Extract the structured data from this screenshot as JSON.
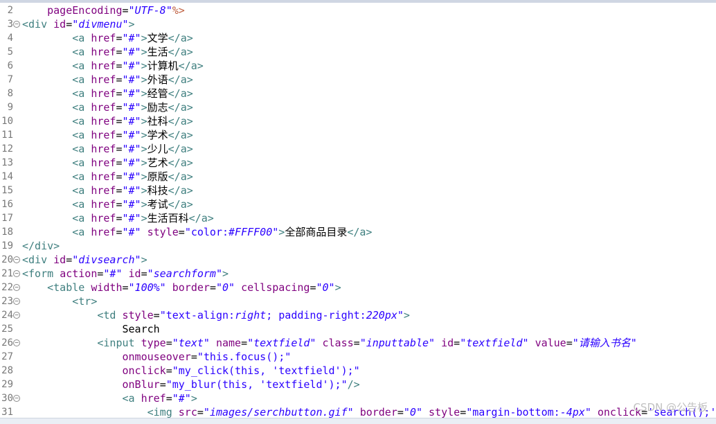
{
  "editor": {
    "lines": [
      {
        "n": "2",
        "fold": false,
        "indent": 4,
        "tokens": [
          [
            "attr",
            "pageEncoding"
          ],
          [
            "punct",
            "="
          ],
          [
            "val",
            "\"UTF-8\""
          ],
          [
            "jsp",
            "%>"
          ]
        ]
      },
      {
        "n": "3",
        "fold": true,
        "indent": 0,
        "tokens": [
          [
            "tag",
            "<div"
          ],
          [
            "txt",
            " "
          ],
          [
            "attr",
            "id"
          ],
          [
            "punct",
            "="
          ],
          [
            "val",
            "\"divmenu\""
          ],
          [
            "tag",
            ">"
          ]
        ]
      },
      {
        "n": "4",
        "fold": false,
        "indent": 8,
        "tokens": [
          [
            "tag",
            "<a"
          ],
          [
            "txt",
            " "
          ],
          [
            "attr",
            "href"
          ],
          [
            "punct",
            "="
          ],
          [
            "val",
            "\"#\""
          ],
          [
            "tag",
            ">"
          ],
          [
            "txt",
            "文学"
          ],
          [
            "tag",
            "</a>"
          ]
        ]
      },
      {
        "n": "5",
        "fold": false,
        "indent": 8,
        "tokens": [
          [
            "tag",
            "<a"
          ],
          [
            "txt",
            " "
          ],
          [
            "attr",
            "href"
          ],
          [
            "punct",
            "="
          ],
          [
            "val",
            "\"#\""
          ],
          [
            "tag",
            ">"
          ],
          [
            "txt",
            "生活"
          ],
          [
            "tag",
            "</a>"
          ]
        ]
      },
      {
        "n": "6",
        "fold": false,
        "indent": 8,
        "tokens": [
          [
            "tag",
            "<a"
          ],
          [
            "txt",
            " "
          ],
          [
            "attr",
            "href"
          ],
          [
            "punct",
            "="
          ],
          [
            "val",
            "\"#\""
          ],
          [
            "tag",
            ">"
          ],
          [
            "txt",
            "计算机"
          ],
          [
            "tag",
            "</a>"
          ]
        ]
      },
      {
        "n": "7",
        "fold": false,
        "indent": 8,
        "tokens": [
          [
            "tag",
            "<a"
          ],
          [
            "txt",
            " "
          ],
          [
            "attr",
            "href"
          ],
          [
            "punct",
            "="
          ],
          [
            "val",
            "\"#\""
          ],
          [
            "tag",
            ">"
          ],
          [
            "txt",
            "外语"
          ],
          [
            "tag",
            "</a>"
          ]
        ]
      },
      {
        "n": "8",
        "fold": false,
        "indent": 8,
        "tokens": [
          [
            "tag",
            "<a"
          ],
          [
            "txt",
            " "
          ],
          [
            "attr",
            "href"
          ],
          [
            "punct",
            "="
          ],
          [
            "val",
            "\"#\""
          ],
          [
            "tag",
            ">"
          ],
          [
            "txt",
            "经管"
          ],
          [
            "tag",
            "</a>"
          ]
        ]
      },
      {
        "n": "9",
        "fold": false,
        "indent": 8,
        "tokens": [
          [
            "tag",
            "<a"
          ],
          [
            "txt",
            " "
          ],
          [
            "attr",
            "href"
          ],
          [
            "punct",
            "="
          ],
          [
            "val",
            "\"#\""
          ],
          [
            "tag",
            ">"
          ],
          [
            "txt",
            "励志"
          ],
          [
            "tag",
            "</a>"
          ]
        ]
      },
      {
        "n": "10",
        "fold": false,
        "indent": 8,
        "tokens": [
          [
            "tag",
            "<a"
          ],
          [
            "txt",
            " "
          ],
          [
            "attr",
            "href"
          ],
          [
            "punct",
            "="
          ],
          [
            "val",
            "\"#\""
          ],
          [
            "tag",
            ">"
          ],
          [
            "txt",
            "社科"
          ],
          [
            "tag",
            "</a>"
          ]
        ]
      },
      {
        "n": "11",
        "fold": false,
        "indent": 8,
        "tokens": [
          [
            "tag",
            "<a"
          ],
          [
            "txt",
            " "
          ],
          [
            "attr",
            "href"
          ],
          [
            "punct",
            "="
          ],
          [
            "val",
            "\"#\""
          ],
          [
            "tag",
            ">"
          ],
          [
            "txt",
            "学术"
          ],
          [
            "tag",
            "</a>"
          ]
        ]
      },
      {
        "n": "12",
        "fold": false,
        "indent": 8,
        "tokens": [
          [
            "tag",
            "<a"
          ],
          [
            "txt",
            " "
          ],
          [
            "attr",
            "href"
          ],
          [
            "punct",
            "="
          ],
          [
            "val",
            "\"#\""
          ],
          [
            "tag",
            ">"
          ],
          [
            "txt",
            "少儿"
          ],
          [
            "tag",
            "</a>"
          ]
        ]
      },
      {
        "n": "13",
        "fold": false,
        "indent": 8,
        "tokens": [
          [
            "tag",
            "<a"
          ],
          [
            "txt",
            " "
          ],
          [
            "attr",
            "href"
          ],
          [
            "punct",
            "="
          ],
          [
            "val",
            "\"#\""
          ],
          [
            "tag",
            ">"
          ],
          [
            "txt",
            "艺术"
          ],
          [
            "tag",
            "</a>"
          ]
        ]
      },
      {
        "n": "14",
        "fold": false,
        "indent": 8,
        "tokens": [
          [
            "tag",
            "<a"
          ],
          [
            "txt",
            " "
          ],
          [
            "attr",
            "href"
          ],
          [
            "punct",
            "="
          ],
          [
            "val",
            "\"#\""
          ],
          [
            "tag",
            ">"
          ],
          [
            "txt",
            "原版"
          ],
          [
            "tag",
            "</a>"
          ]
        ]
      },
      {
        "n": "15",
        "fold": false,
        "indent": 8,
        "tokens": [
          [
            "tag",
            "<a"
          ],
          [
            "txt",
            " "
          ],
          [
            "attr",
            "href"
          ],
          [
            "punct",
            "="
          ],
          [
            "val",
            "\"#\""
          ],
          [
            "tag",
            ">"
          ],
          [
            "txt",
            "科技"
          ],
          [
            "tag",
            "</a>"
          ]
        ]
      },
      {
        "n": "16",
        "fold": false,
        "indent": 8,
        "tokens": [
          [
            "tag",
            "<a"
          ],
          [
            "txt",
            " "
          ],
          [
            "attr",
            "href"
          ],
          [
            "punct",
            "="
          ],
          [
            "val",
            "\"#\""
          ],
          [
            "tag",
            ">"
          ],
          [
            "txt",
            "考试"
          ],
          [
            "tag",
            "</a>"
          ]
        ]
      },
      {
        "n": "17",
        "fold": false,
        "indent": 8,
        "tokens": [
          [
            "tag",
            "<a"
          ],
          [
            "txt",
            " "
          ],
          [
            "attr",
            "href"
          ],
          [
            "punct",
            "="
          ],
          [
            "val",
            "\"#\""
          ],
          [
            "tag",
            ">"
          ],
          [
            "txt",
            "生活百科"
          ],
          [
            "tag",
            "</a>"
          ]
        ]
      },
      {
        "n": "18",
        "fold": false,
        "indent": 8,
        "tokens": [
          [
            "tag",
            "<a"
          ],
          [
            "txt",
            " "
          ],
          [
            "attr",
            "href"
          ],
          [
            "punct",
            "="
          ],
          [
            "val",
            "\"#\""
          ],
          [
            "txt",
            " "
          ],
          [
            "attr",
            "style"
          ],
          [
            "punct",
            "="
          ],
          [
            "sval",
            "\"color:"
          ],
          [
            "val",
            "#FFFF00"
          ],
          [
            "sval",
            "\""
          ],
          [
            "tag",
            ">"
          ],
          [
            "txt",
            "全部商品目录"
          ],
          [
            "tag",
            "</a>"
          ]
        ]
      },
      {
        "n": "19",
        "fold": false,
        "indent": 0,
        "tokens": [
          [
            "tag",
            "</div>"
          ]
        ]
      },
      {
        "n": "20",
        "fold": true,
        "indent": 0,
        "tokens": [
          [
            "tag",
            "<div"
          ],
          [
            "txt",
            " "
          ],
          [
            "attr",
            "id"
          ],
          [
            "punct",
            "="
          ],
          [
            "val",
            "\"divsearch\""
          ],
          [
            "tag",
            ">"
          ]
        ]
      },
      {
        "n": "21",
        "fold": true,
        "indent": 0,
        "tokens": [
          [
            "tag",
            "<form"
          ],
          [
            "txt",
            " "
          ],
          [
            "attr",
            "action"
          ],
          [
            "punct",
            "="
          ],
          [
            "val",
            "\"#\""
          ],
          [
            "txt",
            " "
          ],
          [
            "attr",
            "id"
          ],
          [
            "punct",
            "="
          ],
          [
            "val",
            "\"searchform\""
          ],
          [
            "tag",
            ">"
          ]
        ]
      },
      {
        "n": "22",
        "fold": true,
        "indent": 4,
        "tokens": [
          [
            "tag",
            "<table"
          ],
          [
            "txt",
            " "
          ],
          [
            "attr",
            "width"
          ],
          [
            "punct",
            "="
          ],
          [
            "val",
            "\"100%\""
          ],
          [
            "txt",
            " "
          ],
          [
            "attr",
            "border"
          ],
          [
            "punct",
            "="
          ],
          [
            "val",
            "\"0\""
          ],
          [
            "txt",
            " "
          ],
          [
            "attr",
            "cellspacing"
          ],
          [
            "punct",
            "="
          ],
          [
            "val",
            "\"0\""
          ],
          [
            "tag",
            ">"
          ]
        ]
      },
      {
        "n": "23",
        "fold": true,
        "indent": 8,
        "tokens": [
          [
            "tag",
            "<tr>"
          ]
        ]
      },
      {
        "n": "24",
        "fold": true,
        "indent": 12,
        "tokens": [
          [
            "tag",
            "<td"
          ],
          [
            "txt",
            " "
          ],
          [
            "attr",
            "style"
          ],
          [
            "punct",
            "="
          ],
          [
            "sval",
            "\"text-align:"
          ],
          [
            "val",
            "right"
          ],
          [
            "sval",
            "; padding-right:"
          ],
          [
            "val",
            "220px"
          ],
          [
            "sval",
            "\""
          ],
          [
            "tag",
            ">"
          ]
        ]
      },
      {
        "n": "25",
        "fold": false,
        "indent": 16,
        "tokens": [
          [
            "txt",
            "Search"
          ]
        ]
      },
      {
        "n": "26",
        "fold": true,
        "indent": 12,
        "tokens": [
          [
            "tag",
            "<input"
          ],
          [
            "txt",
            " "
          ],
          [
            "attr",
            "type"
          ],
          [
            "punct",
            "="
          ],
          [
            "val",
            "\"text\""
          ],
          [
            "txt",
            " "
          ],
          [
            "attr",
            "name"
          ],
          [
            "punct",
            "="
          ],
          [
            "val",
            "\"textfield\""
          ],
          [
            "txt",
            " "
          ],
          [
            "attr",
            "class"
          ],
          [
            "punct",
            "="
          ],
          [
            "val",
            "\"inputtable\""
          ],
          [
            "txt",
            " "
          ],
          [
            "attr",
            "id"
          ],
          [
            "punct",
            "="
          ],
          [
            "val",
            "\"textfield\""
          ],
          [
            "txt",
            " "
          ],
          [
            "attr",
            "value"
          ],
          [
            "punct",
            "="
          ],
          [
            "val",
            "\"请输入书名\""
          ]
        ]
      },
      {
        "n": "27",
        "fold": false,
        "indent": 16,
        "tokens": [
          [
            "attr",
            "onmouseover"
          ],
          [
            "punct",
            "="
          ],
          [
            "sval",
            "\"this.focus();\""
          ]
        ]
      },
      {
        "n": "28",
        "fold": false,
        "indent": 16,
        "tokens": [
          [
            "attr",
            "onclick"
          ],
          [
            "punct",
            "="
          ],
          [
            "sval",
            "\"my_click(this, 'textfield');\""
          ]
        ]
      },
      {
        "n": "29",
        "fold": false,
        "indent": 16,
        "tokens": [
          [
            "attr",
            "onBlur"
          ],
          [
            "punct",
            "="
          ],
          [
            "sval",
            "\"my_blur(this, 'textfield');\""
          ],
          [
            "tag",
            "/>"
          ]
        ]
      },
      {
        "n": "30",
        "fold": true,
        "indent": 16,
        "tokens": [
          [
            "tag",
            "<a"
          ],
          [
            "txt",
            " "
          ],
          [
            "attr",
            "href"
          ],
          [
            "punct",
            "="
          ],
          [
            "val",
            "\"#\""
          ],
          [
            "tag",
            ">"
          ]
        ]
      },
      {
        "n": "31",
        "fold": false,
        "indent": 20,
        "tokens": [
          [
            "tag",
            "<img"
          ],
          [
            "txt",
            " "
          ],
          [
            "attr",
            "src"
          ],
          [
            "punct",
            "="
          ],
          [
            "val",
            "\"images/serchbutton.gif\""
          ],
          [
            "txt",
            " "
          ],
          [
            "attr",
            "border"
          ],
          [
            "punct",
            "="
          ],
          [
            "val",
            "\"0\""
          ],
          [
            "txt",
            " "
          ],
          [
            "attr",
            "style"
          ],
          [
            "punct",
            "="
          ],
          [
            "sval",
            "\"margin-bottom:"
          ],
          [
            "val",
            "-4px"
          ],
          [
            "sval",
            "\""
          ],
          [
            "txt",
            " "
          ],
          [
            "attr",
            "onclick"
          ],
          [
            "punct",
            "="
          ],
          [
            "sval",
            "'search();'"
          ]
        ]
      }
    ]
  },
  "watermark": "CSDN @公告板"
}
